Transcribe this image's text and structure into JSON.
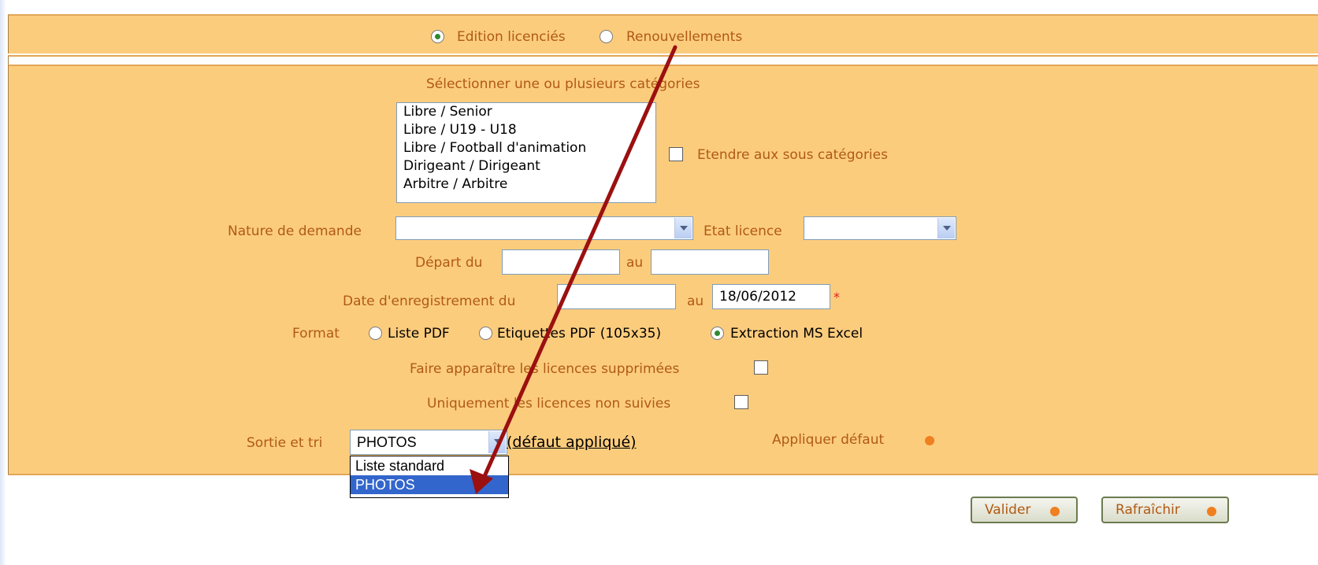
{
  "header": {
    "mode_options": [
      "Edition licenciés",
      "Renouvellements"
    ],
    "mode_selected": "Edition licenciés"
  },
  "categories": {
    "title": "Sélectionner une ou plusieurs catégories",
    "items": [
      "Libre / Senior",
      "Libre / U19 - U18",
      "Libre / Football d'animation",
      "Dirigeant / Dirigeant",
      "Arbitre / Arbitre"
    ],
    "extend_label": "Etendre aux sous catégories"
  },
  "filters": {
    "nature_label": "Nature de demande",
    "nature_value": "",
    "etat_label": "Etat licence",
    "etat_value": "",
    "depart_label": "Départ du",
    "depart_from": "",
    "au_label": "au",
    "depart_to": "",
    "date_label": "Date d'enregistrement du",
    "date_from": "",
    "date_au_label": "au",
    "date_to": "18/06/2012",
    "required_mark": "*"
  },
  "format": {
    "label": "Format",
    "options": [
      "Liste PDF",
      "Etiquettes PDF (105x35)",
      "Extraction MS Excel"
    ],
    "selected": "Extraction MS Excel"
  },
  "options": {
    "show_deleted_label": "Faire apparaître les licences supprimées",
    "only_unfollowed_label": "Uniquement les licences non suivies"
  },
  "sortie": {
    "label": "Sortie et tri",
    "value": "PHOTOS",
    "default_link": "(défaut appliqué)",
    "apply_default_label": "Appliquer défaut",
    "dropdown_options": [
      "Liste standard",
      "PHOTOS"
    ],
    "dropdown_selected": "PHOTOS"
  },
  "actions": {
    "validate_label": "Valider",
    "refresh_label": "Rafraîchir"
  },
  "colors": {
    "panel": "#fccc7d",
    "label": "#b05a14",
    "accent_dot": "#f07f1f",
    "annotation_arrow": "#9b1010"
  }
}
